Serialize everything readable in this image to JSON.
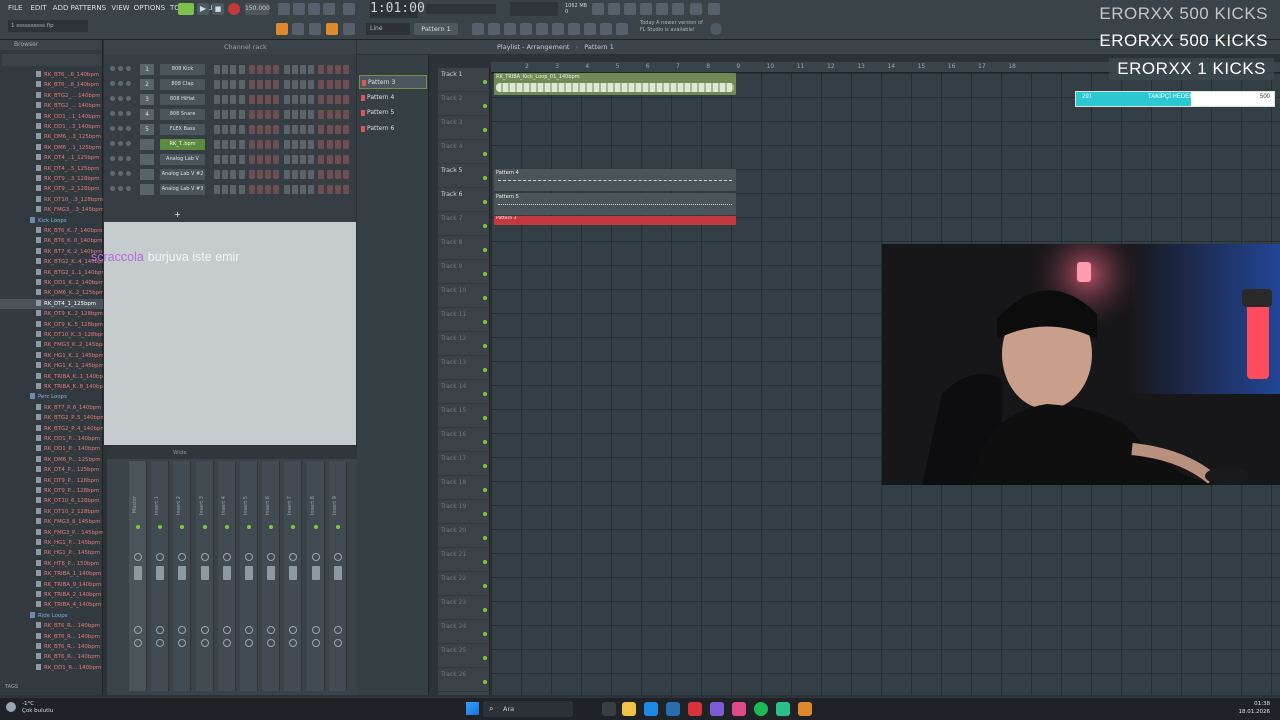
{
  "menu": [
    "FILE",
    "EDIT",
    "ADD",
    "PATTERNS",
    "VIEW",
    "OPTIONS",
    "TOOLS",
    "HELP"
  ],
  "project_file": "1 ssssssssss.flp",
  "transport": {
    "tempo": "150.000",
    "time": "1:01:00",
    "pattern_button": "Pattern 1",
    "snap": "Line"
  },
  "news": {
    "line1": "Today  A newer version of",
    "line2": "FL Studio is available!"
  },
  "overlay": {
    "kick_lines": [
      "ERORXX  500 KICKS",
      "ERORXX  500 KICKS",
      "ERORXX  1 KICKS"
    ],
    "goal": {
      "current": "291",
      "label": "TAKİPÇİ HEDEFİ",
      "target": "500",
      "progress": 0.582,
      "fill_color": "#2cc8d2"
    }
  },
  "chat": {
    "user": "scraccola",
    "message": "burjuva iste emir"
  },
  "browser": {
    "title": "Browser",
    "items": [
      {
        "label": "RK_BT6_..6_140bpm",
        "type": "file"
      },
      {
        "label": "RK_BT6_..8_140bpm",
        "type": "file"
      },
      {
        "label": "RK_BTG2_... 140bpm",
        "type": "file"
      },
      {
        "label": "RK_BTG2_... 140bpm",
        "type": "file"
      },
      {
        "label": "RK_DD1_..1_140bpm",
        "type": "file"
      },
      {
        "label": "RK_DD1_..3_140bpm",
        "type": "file"
      },
      {
        "label": "RK_DM6_..3_125bpm",
        "type": "file"
      },
      {
        "label": "RK_DM6_..1_125bpm",
        "type": "file"
      },
      {
        "label": "RK_DT4_..1_125bpm",
        "type": "file"
      },
      {
        "label": "RK_DT4_..5_125bpm",
        "type": "file"
      },
      {
        "label": "RK_DT9_..3_128bpm",
        "type": "file"
      },
      {
        "label": "RK_DT9_..2_128bpm",
        "type": "file"
      },
      {
        "label": "RK_DT10_..3_128bpm",
        "type": "file"
      },
      {
        "label": "RK_FMG3_..3_145bpm",
        "type": "file"
      },
      {
        "label": "Kick Loops",
        "type": "folder"
      },
      {
        "label": "RK_BT6_K..7_140bpm",
        "type": "file"
      },
      {
        "label": "RK_BT6_K..0_140bpm",
        "type": "file"
      },
      {
        "label": "RK_BT7_K..2_140bpm",
        "type": "file"
      },
      {
        "label": "RK_BTG2_K..4_140bpm",
        "type": "file"
      },
      {
        "label": "RK_BTG2_1..1_140bpm",
        "type": "file"
      },
      {
        "label": "RK_DD1_K..2_140bpm",
        "type": "file"
      },
      {
        "label": "RK_DM6_K..2_125bpm",
        "type": "file"
      },
      {
        "label": "RK_DT4_1_125bpm",
        "type": "file",
        "selected": true
      },
      {
        "label": "RK_DT9_K..2_128bpm",
        "type": "file"
      },
      {
        "label": "RK_DT9_K..5_128bpm",
        "type": "file"
      },
      {
        "label": "RK_DT10_K..3_128bpm",
        "type": "file"
      },
      {
        "label": "RK_FMG3_K..2_145bpm",
        "type": "file"
      },
      {
        "label": "RK_HG1_K..1_145bpm",
        "type": "file"
      },
      {
        "label": "RK_HG1_K..1_145bpm",
        "type": "file"
      },
      {
        "label": "RK_TRIBA_K..1_140bpm",
        "type": "file"
      },
      {
        "label": "RK_TRIBA_K..8_140bpm",
        "type": "file"
      },
      {
        "label": "Perc Loops",
        "type": "folder"
      },
      {
        "label": "RK_BT7_P..6_140bpm",
        "type": "file"
      },
      {
        "label": "RK_BTG2_P..5_140bpm",
        "type": "file"
      },
      {
        "label": "RK_BTG2_P..4_140bpm",
        "type": "file"
      },
      {
        "label": "RK_DD1_P... 140bpm",
        "type": "file"
      },
      {
        "label": "RK_DD1_P... 140bpm",
        "type": "file"
      },
      {
        "label": "RK_DM6_P... 125bpm",
        "type": "file"
      },
      {
        "label": "RK_DT4_P... 125bpm",
        "type": "file"
      },
      {
        "label": "RK_DT9_P... 128bpm",
        "type": "file"
      },
      {
        "label": "RK_DT9_P... 128bpm",
        "type": "file"
      },
      {
        "label": "RK_DT10_6_128bpm",
        "type": "file"
      },
      {
        "label": "RK_DT10_2_128bpm",
        "type": "file"
      },
      {
        "label": "RK_FMG3_8_145bpm",
        "type": "file"
      },
      {
        "label": "RK_FMG3_P... 145bpm",
        "type": "file"
      },
      {
        "label": "RK_HG1_P... 145bpm",
        "type": "file"
      },
      {
        "label": "RK_HG1_P... 145bpm",
        "type": "file"
      },
      {
        "label": "RK_HT6_P... 150bpm",
        "type": "file"
      },
      {
        "label": "RK_TRIBA_1_140bpm",
        "type": "file"
      },
      {
        "label": "RK_TRIBA_9_140bpm",
        "type": "file"
      },
      {
        "label": "RK_TRIBA_2_140bpm",
        "type": "file"
      },
      {
        "label": "RK_TRIBA_4_140bpm",
        "type": "file"
      },
      {
        "label": "Ride Loops",
        "type": "folder"
      },
      {
        "label": "RK_BT6_R... 140bpm",
        "type": "file"
      },
      {
        "label": "RK_BT6_R... 140bpm",
        "type": "file"
      },
      {
        "label": "RK_BT6_R... 140bpm",
        "type": "file"
      },
      {
        "label": "RK_BT6_R... 140bpm",
        "type": "file"
      },
      {
        "label": "RK_DD1_R... 140bpm",
        "type": "file"
      }
    ],
    "tags_label": "TAGS"
  },
  "channel_rack": {
    "title": "Channel rack",
    "channels": [
      {
        "num": "1",
        "name": "808 Kick"
      },
      {
        "num": "2",
        "name": "808 Clap"
      },
      {
        "num": "3",
        "name": "808 HiHat"
      },
      {
        "num": "4",
        "name": "808 Snare"
      },
      {
        "num": "5",
        "name": "FLEX Bass"
      },
      {
        "num": "",
        "name": "RK_T..bpm",
        "selected": true
      },
      {
        "num": "",
        "name": "Analog Lab V"
      },
      {
        "num": "",
        "name": "Analog Lab V #2"
      },
      {
        "num": "",
        "name": "Analog Lab V #3"
      }
    ]
  },
  "mixer": {
    "label": "Wide",
    "strips": [
      "Master",
      "Insert 1",
      "Insert 2",
      "Insert 3",
      "Insert 4",
      "Insert 5",
      "Insert 6",
      "Insert 7",
      "Insert 8",
      "Insert 9"
    ]
  },
  "patterns": [
    "Pattern 3",
    "Pattern 4",
    "Pattern 5",
    "Pattern 6"
  ],
  "playlist": {
    "title": "Playlist - Arrangement",
    "crumb": "Pattern 1",
    "ruler": [
      "2",
      "3",
      "4",
      "5",
      "6",
      "7",
      "8",
      "9",
      "10",
      "11",
      "12",
      "13",
      "14",
      "15",
      "16",
      "17",
      "18"
    ],
    "tracks": [
      "Track 1",
      "Track 2",
      "Track 3",
      "Track 4",
      "Track 5",
      "Track 6",
      "Track 7",
      "Track 8",
      "Track 9",
      "Track 10",
      "Track 11",
      "Track 12",
      "Track 13",
      "Track 14",
      "Track 15",
      "Track 16",
      "Track 17",
      "Track 18",
      "Track 19",
      "Track 20",
      "Track 21",
      "Track 22",
      "Track 23",
      "Track 24",
      "Track 25",
      "Track 26"
    ],
    "clips": [
      {
        "label": "RK_TRIBA_Kick_Loop_01_140bpm",
        "color": "#6f8a55"
      },
      {
        "label": "Pattern 4",
        "color": "#4a5459"
      },
      {
        "label": "Pattern 5",
        "color": "#4a5459"
      },
      {
        "label": "Pattern 3",
        "color": "#c4393f"
      }
    ]
  },
  "taskbar": {
    "weather_temp": "-1°C",
    "weather_text": "Çok bulutlu",
    "search_label": "Ara",
    "time": "01:38",
    "date": "18.01.2026"
  }
}
